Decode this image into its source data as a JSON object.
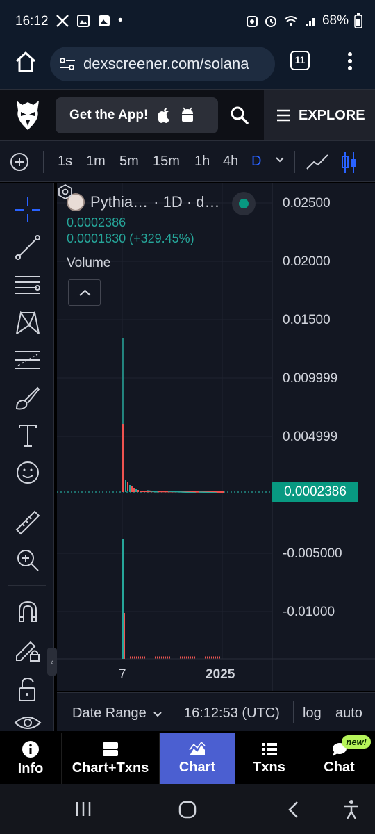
{
  "status_bar": {
    "time": "16:12",
    "battery": "68%"
  },
  "browser": {
    "url": "dexscreener.com/solana",
    "tab_count": "11"
  },
  "header": {
    "get_app_label": "Get the App!",
    "explore_label": "EXPLORE"
  },
  "timeframes": {
    "items": [
      "1s",
      "1m",
      "5m",
      "15m",
      "1h",
      "4h",
      "D"
    ],
    "active": "D"
  },
  "legend": {
    "symbol": "Pythia…",
    "interval_source": "· 1D · d…",
    "price": "0.0002386",
    "change": "0.0001830 (+329.45%)",
    "volume_label": "Volume"
  },
  "price_axis": {
    "labels": [
      "0.02500",
      "0.02000",
      "0.01500",
      "0.009999",
      "0.004999",
      "-0.005000",
      "-0.01000"
    ],
    "current_price_tag": "0.0002386"
  },
  "time_axis": {
    "labels": [
      "7",
      "2025"
    ]
  },
  "range_bar": {
    "date_range_label": "Date Range",
    "clock": "16:12:53 (UTC)",
    "log_label": "log",
    "auto_label": "auto"
  },
  "bottom_tabs": [
    {
      "label": "Info",
      "icon": "info-icon"
    },
    {
      "label": "Chart+Txns",
      "icon": "split-view-icon"
    },
    {
      "label": "Chart",
      "icon": "chart-icon"
    },
    {
      "label": "Txns",
      "icon": "list-icon"
    },
    {
      "label": "Chat",
      "icon": "chat-icon"
    }
  ],
  "chat_badge": "new!",
  "colors": {
    "up": "#26a69a",
    "down": "#ef5350",
    "accent": "#2962ff",
    "active_tab": "#4b5fd1",
    "badge": "#b6f45a"
  }
}
